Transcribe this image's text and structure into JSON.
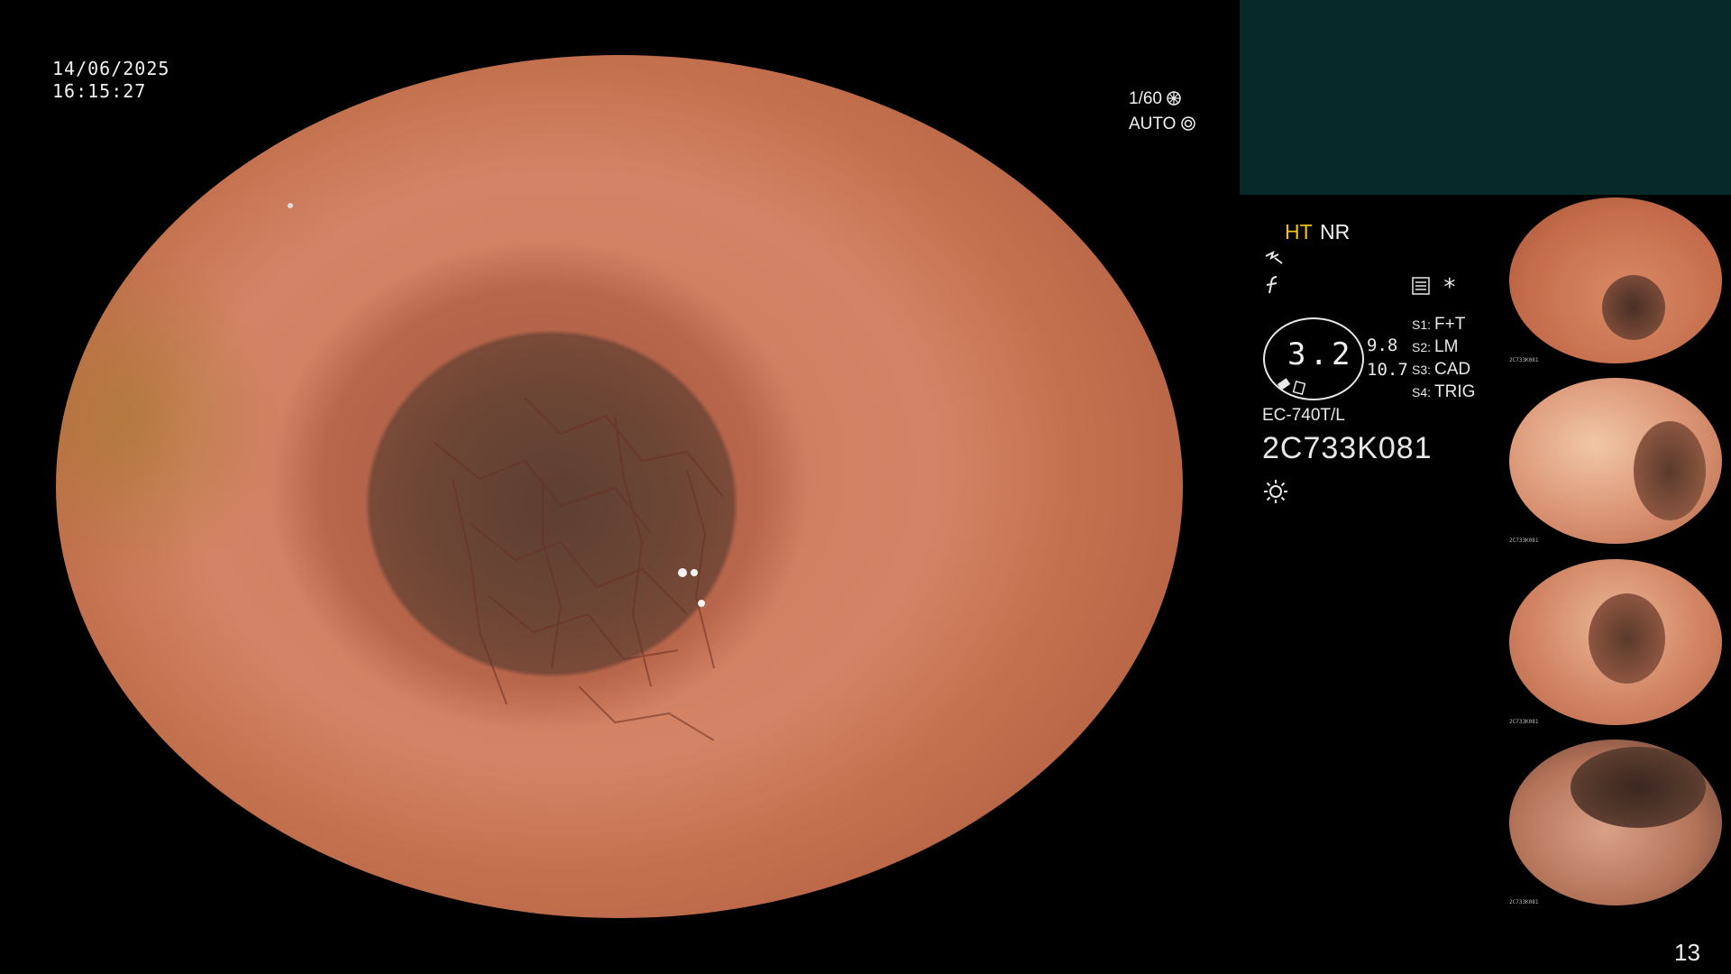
{
  "overlay": {
    "date": "14/06/2025",
    "time": "16:15:27",
    "shutter": "1/60",
    "mode": "AUTO"
  },
  "settings": {
    "ht": "HT",
    "nr": "NR",
    "zoom": "3.2",
    "value_a": "9.8",
    "value_b": "10.7",
    "asterisk": "*",
    "switches": [
      {
        "key": "S1:",
        "value": "F+T"
      },
      {
        "key": "S2:",
        "value": "LM"
      },
      {
        "key": "S3:",
        "value": "CAD"
      },
      {
        "key": "S4:",
        "value": "TRIG"
      }
    ],
    "scope_model": "EC-740T/L",
    "scope_serial": "2C733K081"
  },
  "thumbnails": [
    {
      "caption": "2C733K081"
    },
    {
      "caption": "2C733K081"
    },
    {
      "caption": "2C733K081"
    },
    {
      "caption": "2C733K081"
    }
  ],
  "colors": {
    "ht_yellow": "#f2c21b",
    "panel_teal": "#062a29",
    "background": "#000000"
  },
  "icons": {
    "shutter": "aperture-icon",
    "auto": "iris-icon",
    "enhance": "enhance-icon",
    "filter": "f-curve-icon",
    "memory": "memory-icon",
    "light": "sun-icon"
  },
  "page_number": "13"
}
